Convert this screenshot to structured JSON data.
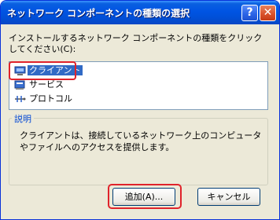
{
  "window": {
    "title": "ネットワーク コンポーネントの種類の選択",
    "help_label": "?",
    "close_label": "✕"
  },
  "instruction": "インストールするネットワーク コンポーネントの種類をクリックしてください(C):",
  "component_list": [
    {
      "label": "クライアント",
      "icon": "client-computer-icon",
      "selected": true
    },
    {
      "label": "サービス",
      "icon": "service-icon",
      "selected": false
    },
    {
      "label": "プロトコル",
      "icon": "protocol-icon",
      "selected": false
    }
  ],
  "description": {
    "group_label": "説明",
    "text": "クライアントは、接続しているネットワーク上のコンピュータやファイルへのアクセスを提供します。"
  },
  "buttons": {
    "add_label": "追加(A)...",
    "cancel_label": "キャンセル"
  },
  "colors": {
    "titlebar": "#0054e3",
    "selection": "#316ac5",
    "annotation": "#e0232b"
  }
}
